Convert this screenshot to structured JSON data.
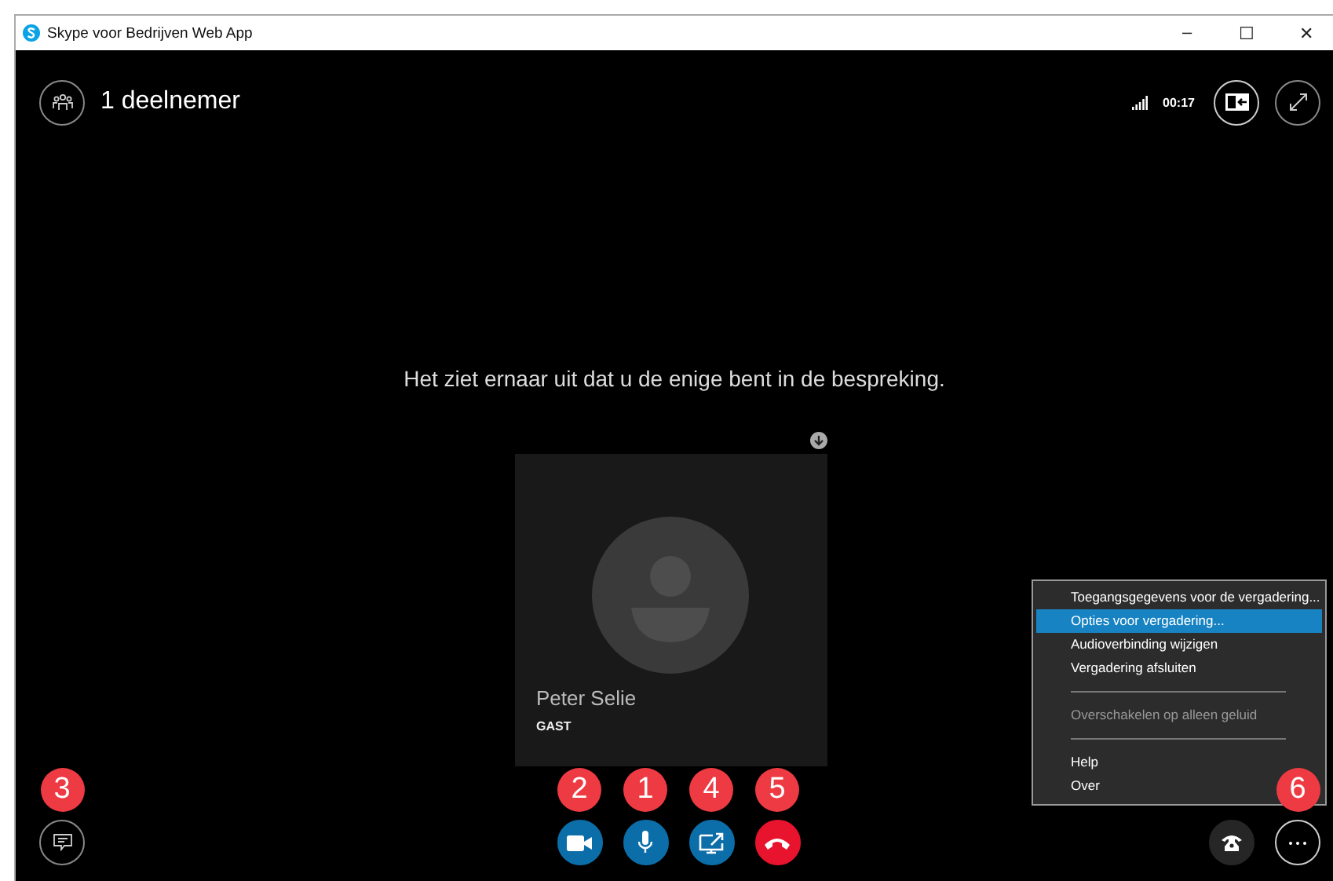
{
  "window": {
    "title": "Skype voor Bedrijven Web App",
    "controls": [
      "–",
      "☐",
      "✕"
    ]
  },
  "header": {
    "participants": "1 deelnemer",
    "timer": "00:17"
  },
  "message": "Het ziet ernaar uit dat u de enige bent in de bespreking.",
  "participant": {
    "name": "Peter Selie",
    "role": "GAST"
  },
  "chat_button": {
    "badge": "3"
  },
  "controls": [
    {
      "kind": "video",
      "badge": "2"
    },
    {
      "kind": "mic",
      "badge": "1"
    },
    {
      "kind": "share",
      "badge": "4"
    },
    {
      "kind": "hangup",
      "badge": "5"
    }
  ],
  "more_button": {
    "badge": "6"
  },
  "menu": [
    {
      "kind": "item",
      "label": "Toegangsgegevens voor de vergadering...",
      "selected": false,
      "disabled": false
    },
    {
      "kind": "item",
      "label": "Opties voor vergadering...",
      "selected": true,
      "disabled": false
    },
    {
      "kind": "item",
      "label": "Audioverbinding wijzigen",
      "selected": false,
      "disabled": false
    },
    {
      "kind": "item",
      "label": "Vergadering afsluiten",
      "selected": false,
      "disabled": false
    },
    {
      "kind": "divider"
    },
    {
      "kind": "item",
      "label": "Overschakelen op alleen geluid",
      "selected": false,
      "disabled": true
    },
    {
      "kind": "divider"
    },
    {
      "kind": "item",
      "label": "Help",
      "selected": false,
      "disabled": false
    },
    {
      "kind": "item",
      "label": "Over",
      "selected": false,
      "disabled": false
    }
  ]
}
